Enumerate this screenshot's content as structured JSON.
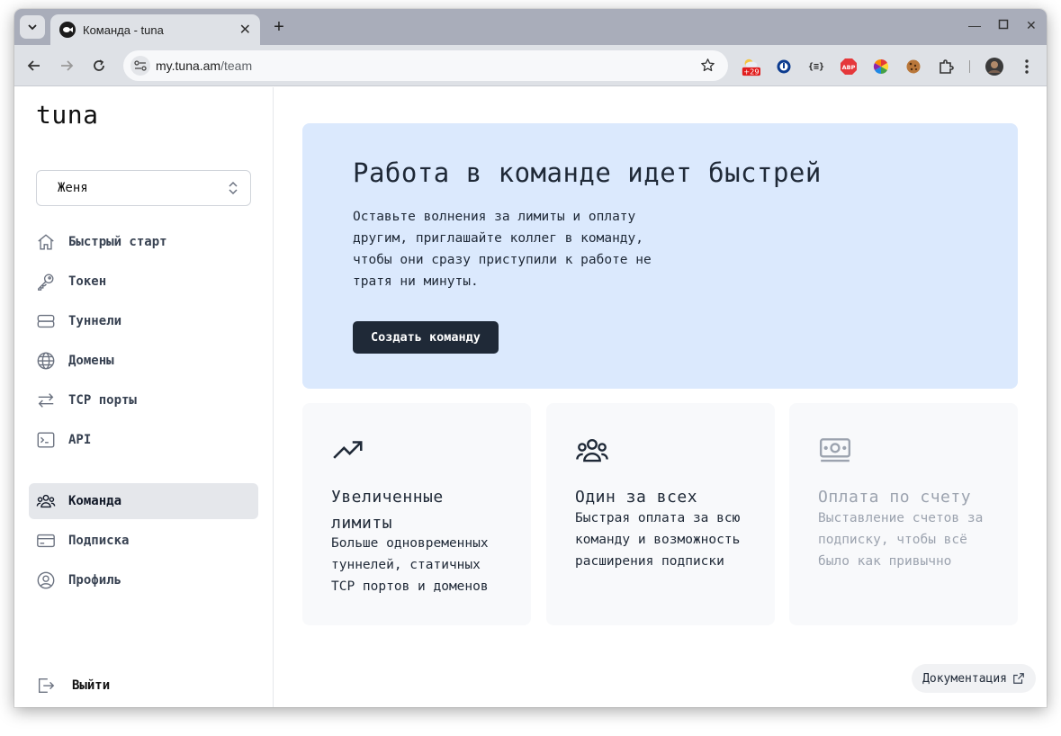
{
  "browser": {
    "tab_title": "Команда - tuna",
    "url_host": "my.tuna.am",
    "url_path": "/team",
    "extension_badge": "+29",
    "abp_label": "ABP"
  },
  "sidebar": {
    "logo": "tuna",
    "account_select": "Женя",
    "items": [
      {
        "label": "Быстрый старт",
        "icon": "home-icon"
      },
      {
        "label": "Токен",
        "icon": "key-icon"
      },
      {
        "label": "Туннели",
        "icon": "server-icon"
      },
      {
        "label": "Домены",
        "icon": "globe-icon"
      },
      {
        "label": "TCP порты",
        "icon": "arrows-icon"
      },
      {
        "label": "API",
        "icon": "terminal-icon"
      }
    ],
    "items2": [
      {
        "label": "Команда",
        "icon": "users-icon",
        "active": true
      },
      {
        "label": "Подписка",
        "icon": "card-icon"
      },
      {
        "label": "Профиль",
        "icon": "user-circle-icon"
      }
    ],
    "logout": "Выйти"
  },
  "hero": {
    "title": "Работа в команде идет быстрей",
    "text": "Оставьте волнения за лимиты и оплату другим, приглашайте коллег в команду, чтобы они сразу приступили к работе не тратя ни минуты.",
    "button": "Создать команду"
  },
  "cards": [
    {
      "title": "Увеличенные лимиты",
      "text": "Больше одновременных туннелей, статичных TCP портов и доменов",
      "icon": "trending-up-icon"
    },
    {
      "title": "Один за всех",
      "text": "Быстрая оплата за всю команду и возможность расширения подписки",
      "icon": "users-icon"
    },
    {
      "title": "Оплата по счету",
      "text": "Выставление счетов за подписку, чтобы всё было как привычно",
      "icon": "banknote-icon"
    }
  ],
  "docs_link": "Документация",
  "colors": {
    "hero_bg": "#dbe9fd",
    "button_bg": "#1f2937",
    "active_nav_bg": "#e5e7eb"
  }
}
